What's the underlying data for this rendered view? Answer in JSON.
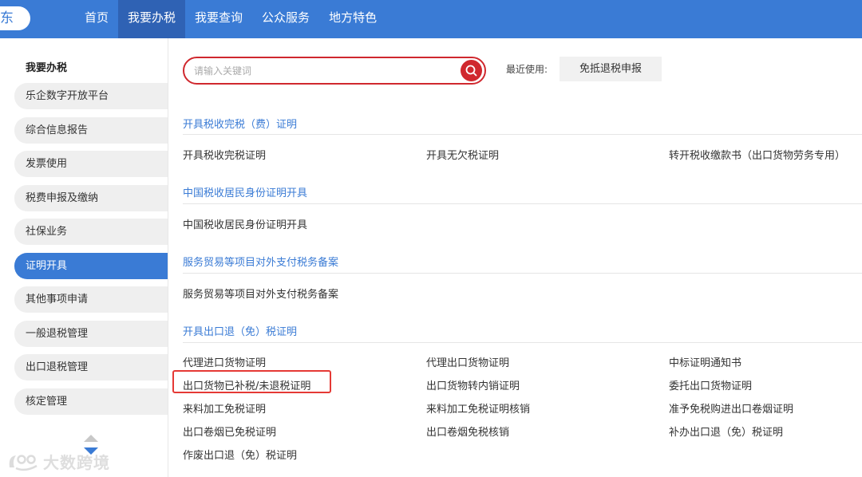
{
  "brand": {
    "logo_text": "东"
  },
  "nav": {
    "items": [
      "首页",
      "我要办税",
      "我要查询",
      "公众服务",
      "地方特色"
    ],
    "active": "我要办税"
  },
  "sidebar": {
    "title": "我要办税",
    "items": [
      "乐企数字开放平台",
      "综合信息报告",
      "发票使用",
      "税费申报及缴纳",
      "社保业务",
      "证明开具",
      "其他事项申请",
      "一般退税管理",
      "出口退税管理",
      "核定管理"
    ],
    "active": "证明开具"
  },
  "search": {
    "placeholder": "请输入关键词",
    "value": ""
  },
  "recent": {
    "label": "最近使用:",
    "button": "免抵退税申报"
  },
  "sections": [
    {
      "title": "开具税收完税（费）证明",
      "links": [
        "开具税收完税证明",
        "开具无欠税证明",
        "转开税收缴款书（出口货物劳务专用）"
      ]
    },
    {
      "title": "中国税收居民身份证明开具",
      "links": [
        "中国税收居民身份证明开具"
      ]
    },
    {
      "title": "服务贸易等项目对外支付税务备案",
      "links": [
        "服务贸易等项目对外支付税务备案"
      ]
    },
    {
      "title": "开具出口退（免）税证明",
      "links": [
        "代理进口货物证明",
        "代理出口货物证明",
        "中标证明通知书",
        "出口货物已补税/未退税证明",
        "出口货物转内销证明",
        "委托出口货物证明",
        "来料加工免税证明",
        "来料加工免税证明核销",
        "准予免税购进出口卷烟证明",
        "出口卷烟已免税证明",
        "出口卷烟免税核销",
        "补办出口退（免）税证明",
        "作废出口退（免）税证明"
      ]
    }
  ],
  "watermark": {
    "text": "大数跨境"
  },
  "colors": {
    "primary": "#3a7bd5",
    "nav_active": "#2f62b4",
    "accent_red": "#d0282e"
  }
}
